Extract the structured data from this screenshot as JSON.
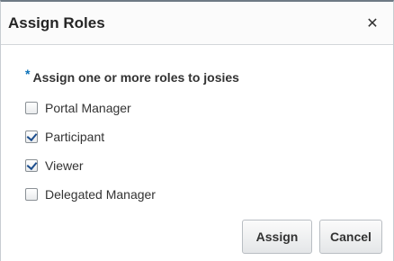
{
  "dialog": {
    "title": "Assign Roles",
    "close_glyph": "✕",
    "close_icon": "close-icon"
  },
  "form": {
    "required_marker": "*",
    "prompt": "Assign one or more roles to josies",
    "roles": [
      {
        "label": "Portal Manager",
        "checked": false
      },
      {
        "label": "Participant",
        "checked": true
      },
      {
        "label": "Viewer",
        "checked": true
      },
      {
        "label": "Delegated Manager",
        "checked": false
      }
    ]
  },
  "footer": {
    "assign_label": "Assign",
    "cancel_label": "Cancel"
  },
  "colors": {
    "required_marker": "#0b72b9",
    "check_mark": "#1e4f8e",
    "title_text": "#252525"
  }
}
